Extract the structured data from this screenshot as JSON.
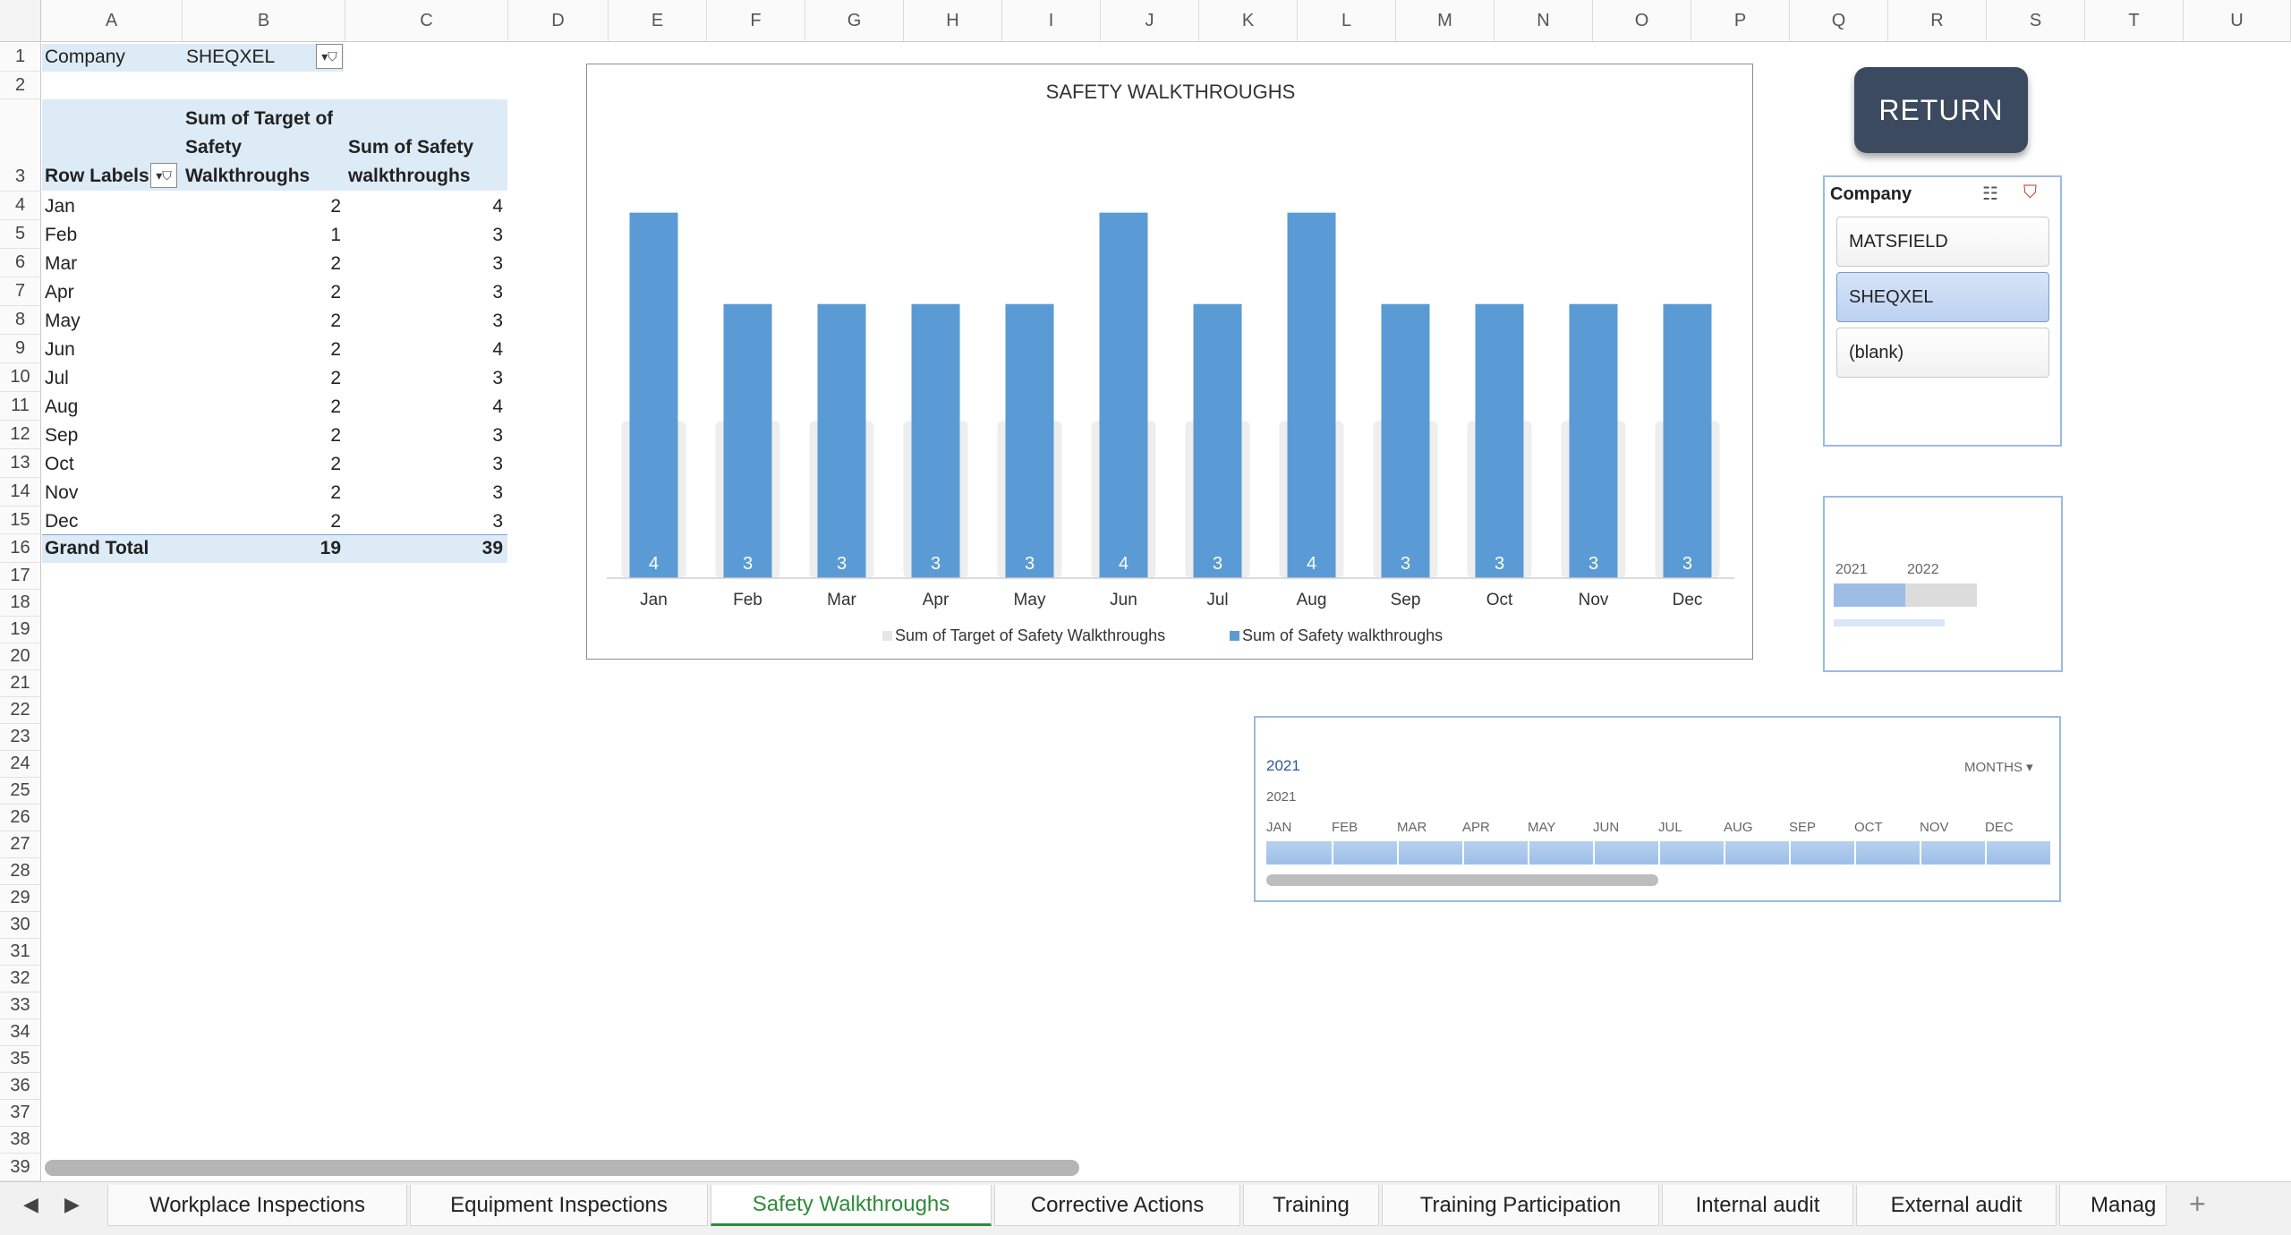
{
  "columns": [
    "A",
    "B",
    "C",
    "D",
    "E",
    "F",
    "G",
    "H",
    "I",
    "J",
    "K",
    "L",
    "M",
    "N",
    "O",
    "P",
    "Q",
    "R",
    "S",
    "T",
    "U"
  ],
  "rows": [
    "1",
    "2",
    "3",
    "4",
    "5",
    "6",
    "7",
    "8",
    "9",
    "10",
    "11",
    "12",
    "13",
    "14",
    "15",
    "16",
    "17",
    "18",
    "19",
    "20",
    "21",
    "22",
    "23",
    "24",
    "25",
    "26",
    "27",
    "28",
    "29",
    "30",
    "31",
    "32",
    "33",
    "34",
    "35",
    "36",
    "37",
    "38",
    "39"
  ],
  "pivot": {
    "filter_label": "Company",
    "filter_value": "SHEQXEL",
    "row_labels": "Row Labels",
    "col_target_l1": "Sum of Target of",
    "col_target_l2": "Safety",
    "col_target_l3": "Walkthroughs",
    "col_actual_l1": "Sum of Safety",
    "col_actual_l2": "walkthroughs",
    "data": [
      {
        "month": "Jan",
        "target": "2",
        "actual": "4"
      },
      {
        "month": "Feb",
        "target": "1",
        "actual": "3"
      },
      {
        "month": "Mar",
        "target": "2",
        "actual": "3"
      },
      {
        "month": "Apr",
        "target": "2",
        "actual": "3"
      },
      {
        "month": "May",
        "target": "2",
        "actual": "3"
      },
      {
        "month": "Jun",
        "target": "2",
        "actual": "4"
      },
      {
        "month": "Jul",
        "target": "2",
        "actual": "3"
      },
      {
        "month": "Aug",
        "target": "2",
        "actual": "4"
      },
      {
        "month": "Sep",
        "target": "2",
        "actual": "3"
      },
      {
        "month": "Oct",
        "target": "2",
        "actual": "3"
      },
      {
        "month": "Nov",
        "target": "2",
        "actual": "3"
      },
      {
        "month": "Dec",
        "target": "2",
        "actual": "3"
      }
    ],
    "total_label": "Grand Total",
    "total_target": "19",
    "total_actual": "39"
  },
  "chart_data": {
    "type": "bar",
    "title": "SAFETY WALKTHROUGHS",
    "categories": [
      "Jan",
      "Feb",
      "Mar",
      "Apr",
      "May",
      "Jun",
      "Jul",
      "Aug",
      "Sep",
      "Oct",
      "Nov",
      "Dec"
    ],
    "series": [
      {
        "name": "Sum of Target of Safety Walkthroughs",
        "values": [
          2,
          1,
          2,
          2,
          2,
          2,
          2,
          2,
          2,
          2,
          2,
          2
        ],
        "color": "#eeeeee"
      },
      {
        "name": "Sum of Safety walkthroughs",
        "values": [
          4,
          3,
          3,
          3,
          3,
          4,
          3,
          4,
          3,
          3,
          3,
          3
        ],
        "color": "#5b9bd5"
      }
    ],
    "ylim": [
      0,
      4.5
    ],
    "grid": false,
    "legend": "bottom"
  },
  "return_label": "RETURN",
  "slicer": {
    "title": "Company",
    "items": [
      {
        "label": "MATSFIELD",
        "selected": false
      },
      {
        "label": "SHEQXEL",
        "selected": true
      },
      {
        "label": "(blank)",
        "selected": false
      }
    ]
  },
  "year_timeline": {
    "years": [
      "2021",
      "2022"
    ]
  },
  "month_timeline": {
    "selected_label": "2021",
    "level": "MONTHS",
    "year": "2021",
    "months": [
      "JAN",
      "FEB",
      "MAR",
      "APR",
      "MAY",
      "JUN",
      "JUL",
      "AUG",
      "SEP",
      "OCT",
      "NOV",
      "DEC"
    ]
  },
  "tabs": [
    {
      "label": "Workplace Inspections",
      "active": false
    },
    {
      "label": "Equipment Inspections",
      "active": false
    },
    {
      "label": "Safety Walkthroughs",
      "active": true
    },
    {
      "label": "Corrective Actions",
      "active": false
    },
    {
      "label": "Training",
      "active": false
    },
    {
      "label": "Training Participation",
      "active": false
    },
    {
      "label": "Internal audit",
      "active": false
    },
    {
      "label": "External audit",
      "active": false
    },
    {
      "label": "Manag",
      "active": false
    }
  ],
  "colors": {
    "accent": "#5b9bd5",
    "header_band": "#ddebf7",
    "active_tab": "#2f8a3a"
  }
}
